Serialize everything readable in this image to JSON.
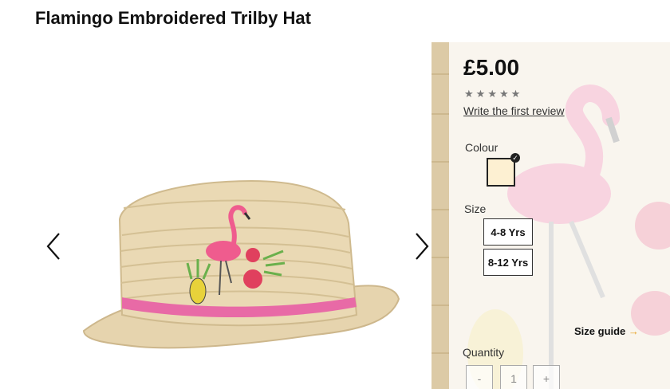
{
  "product": {
    "title": "Flamingo Embroidered Trilby Hat"
  },
  "gallery": {
    "prev_icon": "chevron-left-icon",
    "next_icon": "chevron-right-icon"
  },
  "details": {
    "price": "£5.00",
    "rating": {
      "stars": 5,
      "filled": 0
    },
    "review_link": "Write the first review",
    "colour_label": "Colour",
    "selected_colour": "#fdf0d2",
    "size_label": "Size",
    "sizes": [
      "4-8 Yrs",
      "8-12 Yrs"
    ],
    "size_guide": "Size guide",
    "quantity_label": "Quantity",
    "quantity": {
      "minus": "-",
      "value": "1",
      "plus": "+"
    }
  }
}
